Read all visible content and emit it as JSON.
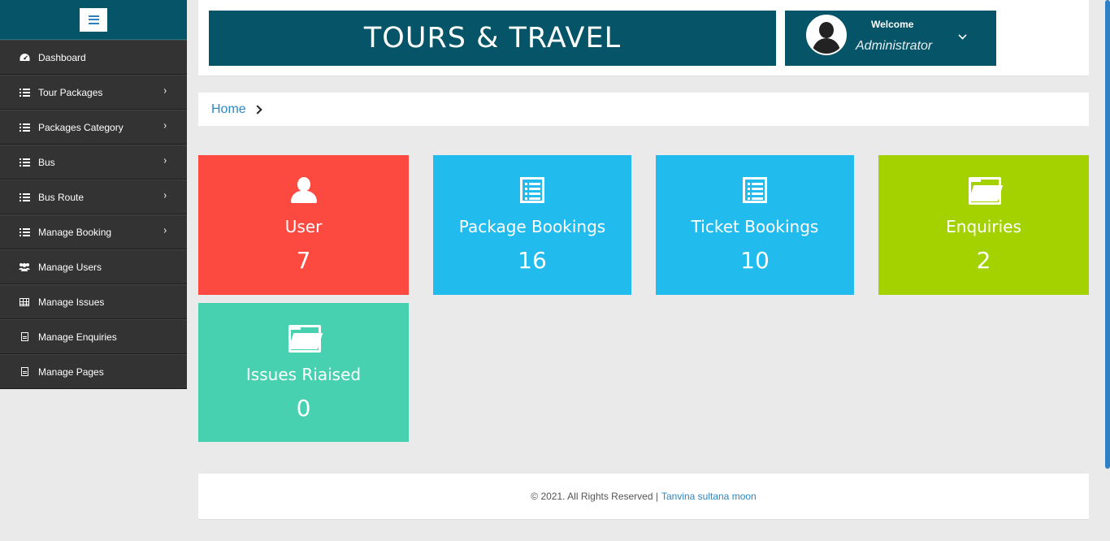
{
  "header": {
    "title": "TOURS & TRAVEL",
    "welcome": "Welcome",
    "user_name": "Administrator"
  },
  "sidebar": {
    "items": [
      {
        "label": "Dashboard",
        "icon": "dashboard-icon"
      },
      {
        "label": "Tour Packages",
        "icon": "list-icon"
      },
      {
        "label": "Packages Category",
        "icon": "list-icon"
      },
      {
        "label": "Bus",
        "icon": "list-icon"
      },
      {
        "label": "Bus Route",
        "icon": "list-icon"
      },
      {
        "label": "Manage Booking",
        "icon": "list-icon"
      },
      {
        "label": "Manage Users",
        "icon": "users-icon"
      },
      {
        "label": "Manage Issues",
        "icon": "table-icon"
      },
      {
        "label": "Manage Enquiries",
        "icon": "file-icon"
      },
      {
        "label": "Manage Pages",
        "icon": "file-icon"
      }
    ]
  },
  "breadcrumb": {
    "home": "Home"
  },
  "tiles": [
    {
      "label": "User",
      "value": "7",
      "color": "#fd4a41",
      "icon": "user-icon"
    },
    {
      "label": "Package Bookings",
      "value": "16",
      "color": "#22bbee",
      "icon": "list-alt-icon"
    },
    {
      "label": "Ticket Bookings",
      "value": "10",
      "color": "#22bbee",
      "icon": "list-alt-icon"
    },
    {
      "label": "Enquiries",
      "value": "2",
      "color": "#a3d200",
      "icon": "folder-open-icon"
    },
    {
      "label": "Issues Riaised",
      "value": "0",
      "color": "#47d1b0",
      "icon": "folder-open-icon"
    }
  ],
  "footer": {
    "copyright": "© 2021. All Rights Reserved |",
    "author": "Tanvina sultana moon"
  },
  "colors": {
    "brand": "#055467",
    "sidebar_bg": "#333333",
    "link": "#2a88c6"
  }
}
